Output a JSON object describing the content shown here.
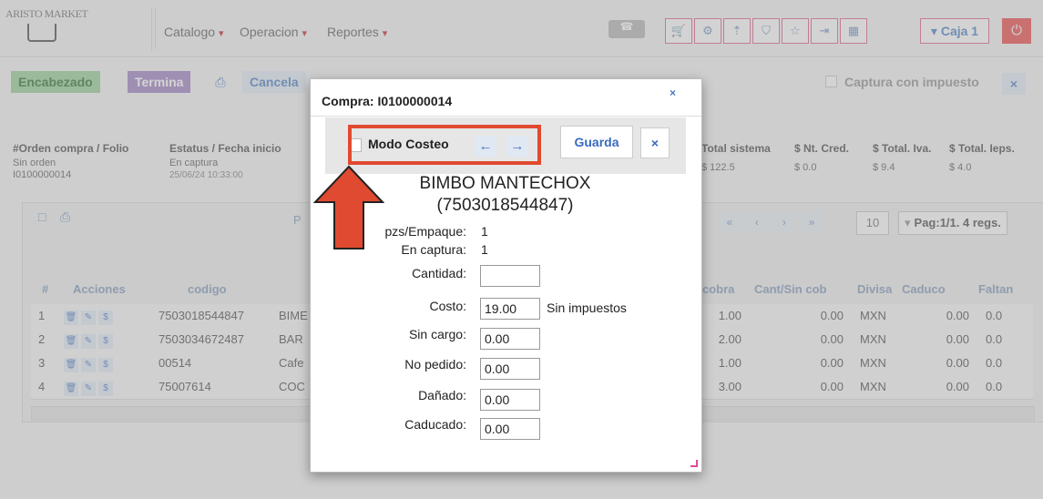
{
  "app": {
    "logo_text": "ARISTO MARKET"
  },
  "nav": {
    "menus": [
      {
        "label": "Catalogo",
        "caret": "▾"
      },
      {
        "label": "Operacion",
        "caret": "▾"
      },
      {
        "label": "Reportes",
        "caret": "▾"
      }
    ],
    "toolbar_icons": [
      "cart-icon",
      "gift-icon",
      "upload-icon",
      "shield-icon",
      "star-icon",
      "login-icon",
      "calculator-icon"
    ],
    "caja_label": "Caja 1",
    "caja_caret": "▾",
    "power_icon": "⏻"
  },
  "toolbar": {
    "encabezado": "Encabezado",
    "termina": "Termina",
    "print_icon": "⎙",
    "cancela": "Cancela",
    "captura_impuesto": "Captura con impuesto",
    "close": "×"
  },
  "header": {
    "orden_label": "#Orden compra / Folio",
    "orden_value": "Sin orden",
    "folio_value": "I0100000014",
    "estatus_label": "Estatus / Fecha inicio",
    "estatus_value": "En captura",
    "fecha_value": "25/06/24 10:33:00",
    "total_sistema_label": "Total sistema",
    "total_sistema_value": "$ 122.5",
    "nt_cred_label": "$ Nt. Cred.",
    "nt_cred_value": "$ 0.0",
    "total_iva_label": "$ Total. Iva.",
    "total_iva_value": "$ 9.4",
    "total_ieps_label": "$ Total. Ieps.",
    "total_ieps_value": "$ 4.0"
  },
  "grid": {
    "left_icons": [
      "□",
      "⎙"
    ],
    "p_label": "P",
    "pager_buttons": [
      "«",
      "‹",
      "›",
      "»"
    ],
    "page_size": "10",
    "page_info": "Pag:1/1. 4 regs.",
    "page_info_caret": "▾",
    "columns": [
      "#",
      "Acciones",
      "codigo",
      "cobra",
      "Cant/Sin cob",
      "Divisa",
      "Caduco",
      "Faltan"
    ],
    "action_icons": [
      "🗑",
      "✎",
      "$"
    ],
    "rows": [
      {
        "n": "1",
        "codigo": "7503018544847",
        "desc": "BIME",
        "cobra": "1.00",
        "cant_sin": "0.00",
        "divisa": "MXN",
        "caduco": "0.00",
        "faltan": "0.0"
      },
      {
        "n": "2",
        "codigo": "7503034672487",
        "desc": "BAR",
        "cobra": "2.00",
        "cant_sin": "0.00",
        "divisa": "MXN",
        "caduco": "0.00",
        "faltan": "0.0"
      },
      {
        "n": "3",
        "codigo": "00514",
        "desc": "Cafe",
        "cobra": "1.00",
        "cant_sin": "0.00",
        "divisa": "MXN",
        "caduco": "0.00",
        "faltan": "0.0"
      },
      {
        "n": "4",
        "codigo": "75007614",
        "desc": "COC",
        "cobra": "3.00",
        "cant_sin": "0.00",
        "divisa": "MXN",
        "caduco": "0.00",
        "faltan": "0.0"
      }
    ]
  },
  "modal": {
    "title": "Compra: I0100000014",
    "close": "×",
    "modo_costeo_label": "Modo Costeo",
    "prev_arrow": "←",
    "next_arrow": "→",
    "guarda_label": "Guarda",
    "guarda_close": "×",
    "product_name": "BIMBO MANTECHOX",
    "product_code": "(7503018544847)",
    "fields": {
      "pzs_label": "pzs/Empaque:",
      "pzs_value": "1",
      "captura_label": "En captura:",
      "captura_value": "1",
      "cantidad_label": "Cantidad:",
      "cantidad_value": "",
      "costo_label": "Costo:",
      "costo_value": "19.00",
      "sin_impuestos": "Sin impuestos",
      "sin_cargo_label": "Sin cargo:",
      "sin_cargo_value": "0.00",
      "no_pedido_label": "No pedido:",
      "no_pedido_value": "0.00",
      "danado_label": "Dañado:",
      "danado_value": "0.00",
      "caducado_label": "Caducado:",
      "caducado_value": "0.00"
    }
  },
  "annotation": {
    "color": "#e04a30"
  }
}
